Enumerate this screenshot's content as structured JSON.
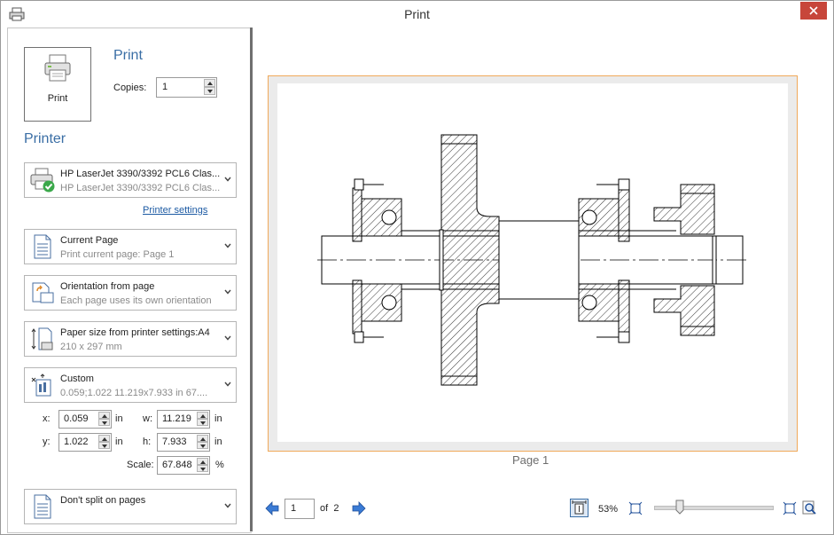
{
  "window": {
    "title": "Print"
  },
  "print_section": {
    "button_label": "Print",
    "heading": "Print",
    "copies_label": "Copies:",
    "copies_value": "1"
  },
  "printer_section": {
    "heading": "Printer",
    "printer": {
      "name": "HP LaserJet 3390/3392 PCL6 Clas...",
      "detail": "HP LaserJet 3390/3392 PCL6 Clas..."
    },
    "settings_link": "Printer settings",
    "range": {
      "title": "Current Page",
      "detail": "Print current page: Page 1"
    },
    "orientation": {
      "title": "Orientation from page",
      "detail": "Each page uses its own orientation"
    },
    "paper": {
      "title": "Paper size from printer settings:A4",
      "detail": "210 x 297 mm"
    },
    "area": {
      "title": "Custom",
      "detail": "0.059;1.022  11.219x7.933 in 67...."
    },
    "fields": {
      "x_label": "x:",
      "x_value": "0.059",
      "x_unit": "in",
      "w_label": "w:",
      "w_value": "11.219",
      "w_unit": "in",
      "y_label": "y:",
      "y_value": "1.022",
      "y_unit": "in",
      "h_label": "h:",
      "h_value": "7.933",
      "h_unit": "in",
      "scale_label": "Scale:",
      "scale_value": "67.848",
      "scale_unit": "%"
    },
    "split": {
      "title": "Don't split on pages"
    }
  },
  "preview": {
    "page_label": "Page 1",
    "nav": {
      "current_page": "1",
      "of_label": "of",
      "total_pages": "2"
    },
    "zoom": {
      "level": "53%",
      "slider_fraction": 0.22
    }
  },
  "colors": {
    "accent": "#3a6ea5",
    "close": "#c7463a",
    "preview_border": "#f0a95a"
  }
}
